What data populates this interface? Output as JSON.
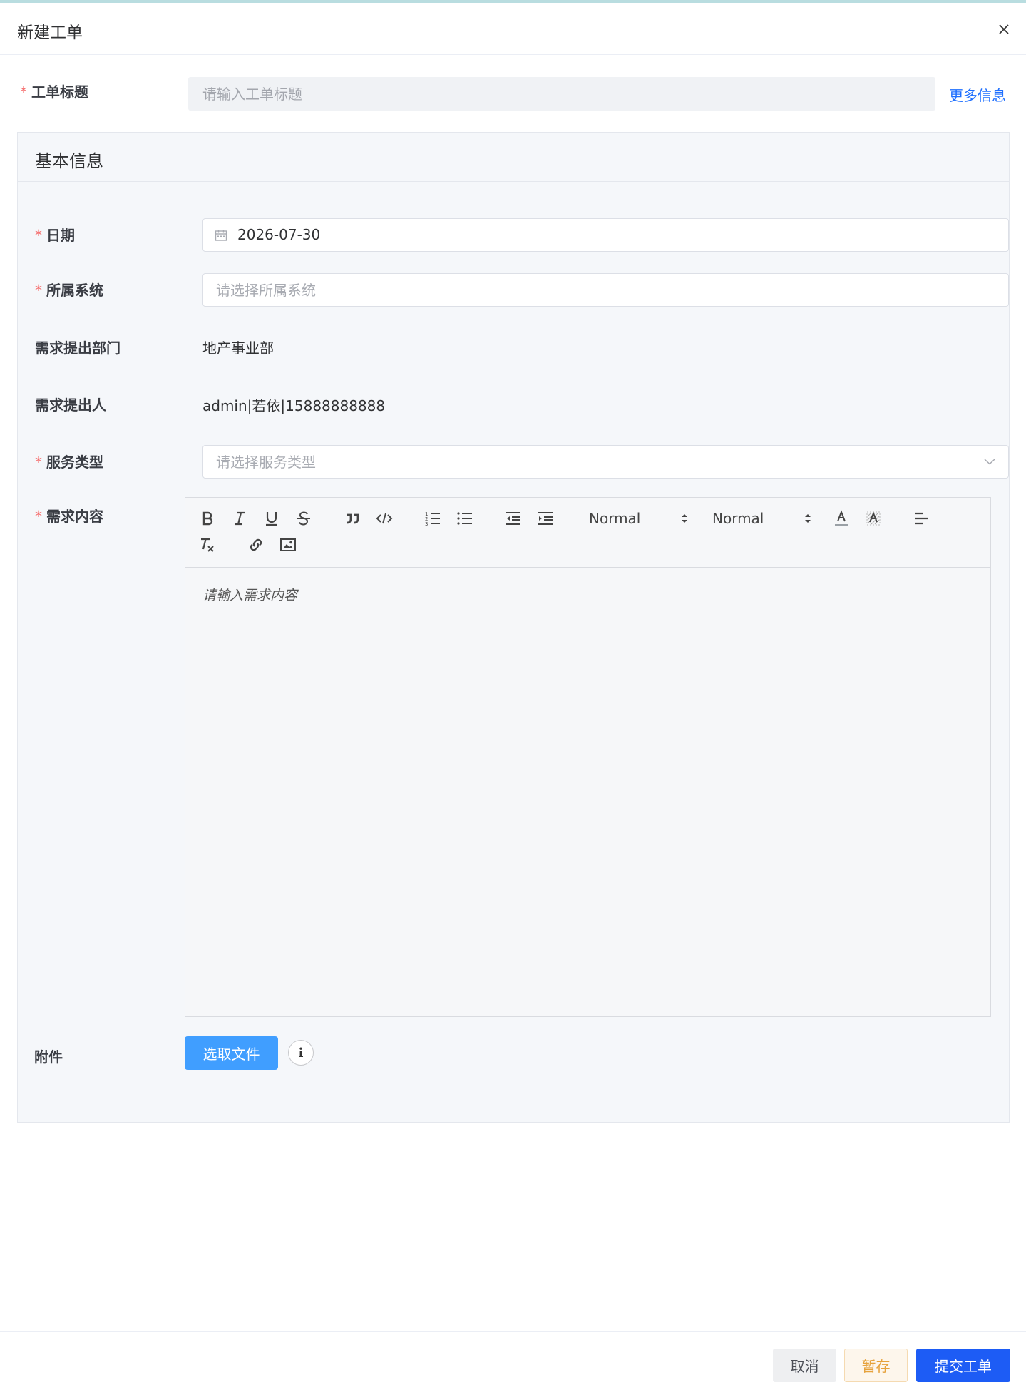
{
  "dialog": {
    "title": "新建工单",
    "close_icon": "close-icon"
  },
  "title_field": {
    "label": "工单标题",
    "placeholder": "请输入工单标题",
    "more_link": "更多信息"
  },
  "section": {
    "title": "基本信息",
    "date": {
      "label": "日期",
      "value": "2026-07-30",
      "icon": "calendar-icon"
    },
    "system": {
      "label": "所属系统",
      "placeholder": "请选择所属系统"
    },
    "department": {
      "label": "需求提出部门",
      "value": "地产事业部"
    },
    "requester": {
      "label": "需求提出人",
      "value": "admin|若依|15888888888"
    },
    "service_type": {
      "label": "服务类型",
      "placeholder": "请选择服务类型",
      "icon": "chevron-down-icon"
    },
    "content": {
      "label": "需求内容",
      "placeholder": "请输入需求内容",
      "toolbar": {
        "size_select": "Normal",
        "header_select": "Normal",
        "buttons": [
          "bold-icon",
          "italic-icon",
          "underline-icon",
          "strike-icon",
          "blockquote-icon",
          "code-block-icon",
          "ordered-list-icon",
          "bullet-list-icon",
          "outdent-icon",
          "indent-icon",
          "font-color-icon",
          "background-color-icon",
          "align-icon",
          "clean-format-icon",
          "link-icon",
          "image-icon"
        ]
      }
    },
    "attachment": {
      "label": "附件",
      "button": "选取文件",
      "info_icon": "info-icon",
      "info_glyph": "i"
    }
  },
  "footer": {
    "cancel": "取消",
    "draft": "暂存",
    "submit": "提交工单"
  }
}
